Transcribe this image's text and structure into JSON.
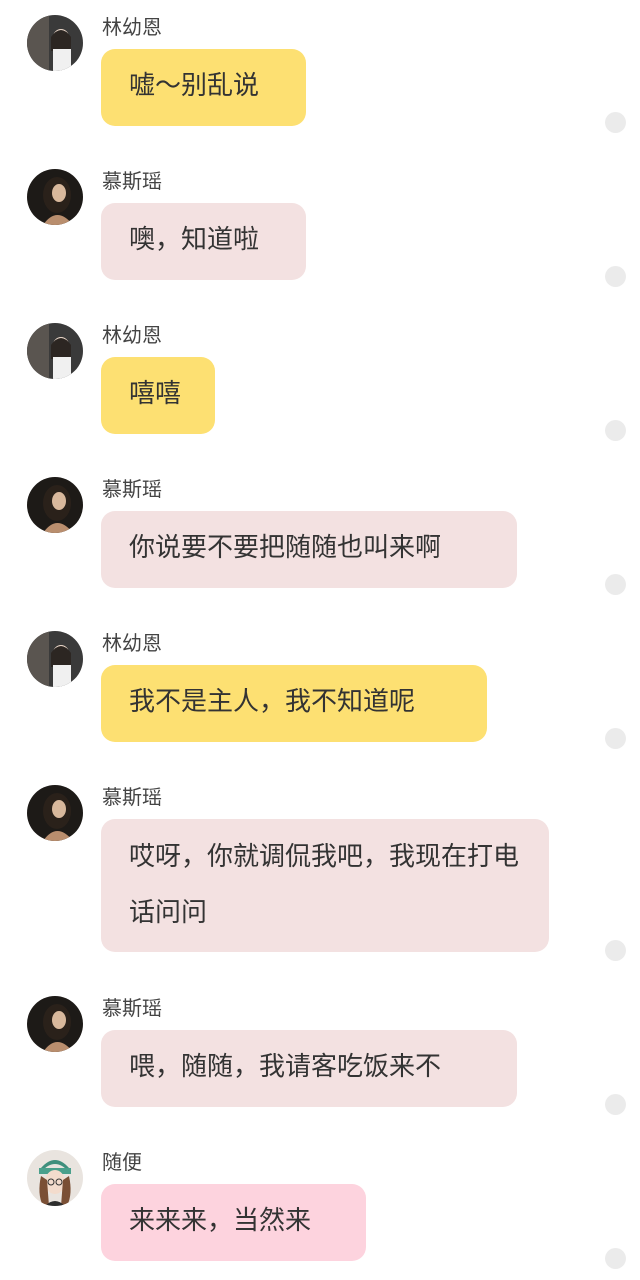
{
  "colors": {
    "bubble_yellow": "#FDE072",
    "bubble_blush": "#F3E1E1",
    "bubble_pink": "#FDD3DE",
    "status_dot": "#ebebeb"
  },
  "messages": [
    {
      "sender": "林幼恩",
      "text": "嘘～别乱说",
      "avatar": "avatar-lin",
      "bubble_color": "yellow"
    },
    {
      "sender": "慕斯瑶",
      "text": "噢，知道啦",
      "avatar": "avatar-mu",
      "bubble_color": "blush"
    },
    {
      "sender": "林幼恩",
      "text": "嘻嘻",
      "avatar": "avatar-lin",
      "bubble_color": "yellow"
    },
    {
      "sender": "慕斯瑶",
      "text": "你说要不要把随随也叫来啊",
      "avatar": "avatar-mu",
      "bubble_color": "blush"
    },
    {
      "sender": "林幼恩",
      "text": "我不是主人，我不知道呢",
      "avatar": "avatar-lin",
      "bubble_color": "yellow"
    },
    {
      "sender": "慕斯瑶",
      "text": "哎呀，你就调侃我吧，我现在打电话问问",
      "avatar": "avatar-mu",
      "bubble_color": "blush"
    },
    {
      "sender": "慕斯瑶",
      "text": "喂，随随，我请客吃饭来不",
      "avatar": "avatar-mu",
      "bubble_color": "blush"
    },
    {
      "sender": "随便",
      "text": "来来来，当然来",
      "avatar": "avatar-sui",
      "bubble_color": "pink"
    }
  ]
}
